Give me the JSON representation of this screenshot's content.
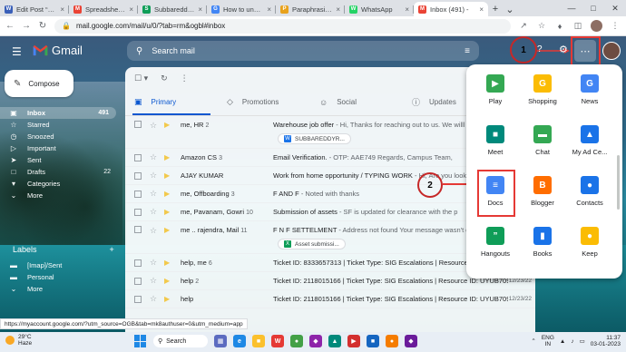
{
  "browser": {
    "tabs": [
      {
        "title": "Edit Post “How",
        "fav": "W",
        "color": "#3a5fb8"
      },
      {
        "title": "Spreadsheet s",
        "fav": "M",
        "color": "#ea4335"
      },
      {
        "title": "Subbareddy ht",
        "fav": "S",
        "color": "#0f9d58"
      },
      {
        "title": "How to unbloc",
        "fav": "G",
        "color": "#4285f4"
      },
      {
        "title": "Paraphrasing T",
        "fav": "P",
        "color": "#e8a21c"
      },
      {
        "title": "WhatsApp",
        "fav": "W",
        "color": "#25d366"
      },
      {
        "title": "Inbox (491) - ",
        "fav": "M",
        "color": "#ea4335"
      }
    ],
    "url": "mail.google.com/mail/u/0/?tab=rm&ogbl#inbox"
  },
  "gmail": {
    "logo_text": "Gmail",
    "search_placeholder": "Search mail",
    "compose_label": "Compose",
    "nav": [
      {
        "label": "Inbox",
        "count": "491",
        "icon": "▣"
      },
      {
        "label": "Starred",
        "count": "",
        "icon": "☆"
      },
      {
        "label": "Snoozed",
        "count": "",
        "icon": "◷"
      },
      {
        "label": "Important",
        "count": "",
        "icon": "▷"
      },
      {
        "label": "Sent",
        "count": "",
        "icon": "➤"
      },
      {
        "label": "Drafts",
        "count": "22",
        "icon": "□"
      },
      {
        "label": "Categories",
        "count": "",
        "icon": "▾"
      },
      {
        "label": "More",
        "count": "",
        "icon": "⌄"
      }
    ],
    "labels_title": "Labels",
    "labels_add": "+",
    "labels": [
      {
        "label": "[Imap]/Sent",
        "icon": "▬"
      },
      {
        "label": "Personal",
        "icon": "▬"
      },
      {
        "label": "More",
        "icon": "⌄"
      }
    ],
    "tabs": [
      {
        "label": "Primary",
        "icon": "▣"
      },
      {
        "label": "Promotions",
        "icon": "◇"
      },
      {
        "label": "Social",
        "icon": "☺"
      },
      {
        "label": "Updates",
        "icon": "ⓘ"
      }
    ],
    "emails": [
      {
        "sender": "me, HR",
        "count": "2",
        "subject": "Warehouse job offer",
        "snippet": " - Hi, Thanks for reaching out to us. We willl get back to you",
        "date": "",
        "attachment": "SUBBAREDDYR...",
        "att_icon": "W",
        "att_color": "#1a73e8"
      },
      {
        "sender": "Amazon CS",
        "count": "3",
        "subject": "Email Verification.",
        "snippet": " - OTP: AAE749 Regards, Campus Team,",
        "date": "",
        "attachment": "",
        "att_icon": "",
        "att_color": ""
      },
      {
        "sender": "AJAY KUMAR",
        "count": "",
        "subject": "Work from home opportunity / TYPING WORK",
        "snippet": " - Hi, Are you look",
        "date": "",
        "attachment": "",
        "att_icon": "",
        "att_color": ""
      },
      {
        "sender": "me, Offboarding",
        "count": "3",
        "subject": "F AND F",
        "snippet": " - Noted with thanks",
        "date": "",
        "attachment": "",
        "att_icon": "",
        "att_color": ""
      },
      {
        "sender": "me, Pavanam, Gowri",
        "count": "10",
        "subject": "Submission of assets",
        "snippet": " - SF is updated for clearance with the p",
        "date": "",
        "attachment": "",
        "att_icon": "",
        "att_color": ""
      },
      {
        "sender": "me .. rajendra, Mail",
        "count": "11",
        "subject": "F N F SETTELMENT",
        "snippet": " - Address not found Your message wasn't d",
        "date": "",
        "attachment": "Asset submissi...",
        "att_icon": "X",
        "att_color": "#0f9d58"
      },
      {
        "sender": "help, me",
        "count": "6",
        "subject": "Ticket ID: 8333657313 | Ticket Type: SIG Escalations | Resource ID: UYUB7092 | Resou",
        "snippet": "",
        "date": "12/27/22",
        "attachment": "",
        "att_icon": "",
        "att_color": ""
      },
      {
        "sender": "help",
        "count": "2",
        "subject": "Ticket ID: 2118015166 | Ticket Type: SIG Escalations | Resource ID: UYUB7092 | Resou",
        "snippet": "",
        "date": "12/23/22",
        "attachment": "",
        "att_icon": "",
        "att_color": ""
      },
      {
        "sender": "help",
        "count": "",
        "subject": "Ticket ID: 2118015166 | Ticket Type: SIG Escalations | Resource ID: UYUB7092 | Resou",
        "snippet": "",
        "date": "12/23/22",
        "attachment": "",
        "att_icon": "",
        "att_color": ""
      }
    ]
  },
  "annotations": {
    "step1": "1",
    "step2": "2"
  },
  "apps": [
    {
      "label": "Play",
      "icon": "▶",
      "color": "#34a853"
    },
    {
      "label": "Shopping",
      "icon": "G",
      "color": "#fbbc04"
    },
    {
      "label": "News",
      "icon": "G",
      "color": "#4285f4"
    },
    {
      "label": "Meet",
      "icon": "■",
      "color": "#00897b"
    },
    {
      "label": "Chat",
      "icon": "▬",
      "color": "#34a853"
    },
    {
      "label": "My Ad Ce...",
      "icon": "▲",
      "color": "#1a73e8"
    },
    {
      "label": "Docs",
      "icon": "≡",
      "color": "#4285f4"
    },
    {
      "label": "Blogger",
      "icon": "B",
      "color": "#ff6d00"
    },
    {
      "label": "Contacts",
      "icon": "●",
      "color": "#1a73e8"
    },
    {
      "label": "Hangouts",
      "icon": "”",
      "color": "#0f9d58"
    },
    {
      "label": "Books",
      "icon": "▮",
      "color": "#1a73e8"
    },
    {
      "label": "Keep",
      "icon": "●",
      "color": "#fbbc04"
    },
    {
      "label": "",
      "icon": "▮",
      "color": "#fbbc04"
    },
    {
      "label": "",
      "icon": "▣",
      "color": "#0f9d58"
    },
    {
      "label": "",
      "icon": "G",
      "color": "#fbbc04"
    }
  ],
  "status_url": "https://myaccount.google.com/?utm_source=OGB&tab=mk8authuser=0&utm_medium=app",
  "taskbar": {
    "temp": "29°C",
    "weather": "Haze",
    "search": "Search",
    "lang1": "ENG",
    "lang2": "IN",
    "time": "11:37",
    "date": "03-01-2023"
  }
}
